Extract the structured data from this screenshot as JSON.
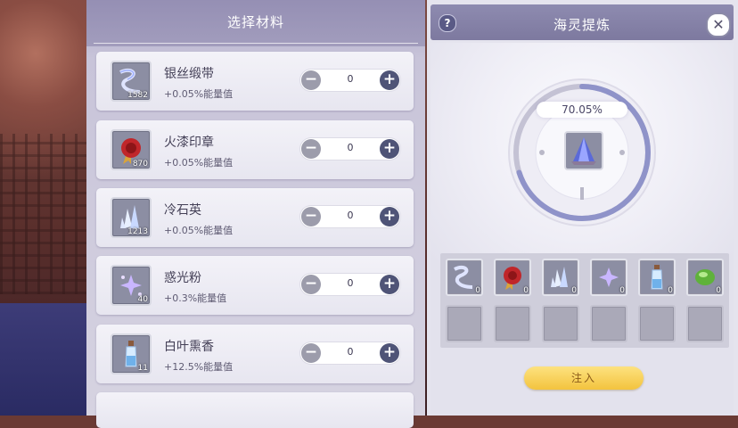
{
  "materials": {
    "title": "选择材料",
    "items": [
      {
        "name": "银丝缎带",
        "effect": "+0.05%能量值",
        "count": "1582",
        "qty": "0",
        "icon": "ribbon-icon"
      },
      {
        "name": "火漆印章",
        "effect": "+0.05%能量值",
        "count": "870",
        "qty": "0",
        "icon": "wax-seal-icon"
      },
      {
        "name": "冷石英",
        "effect": "+0.05%能量值",
        "count": "1213",
        "qty": "0",
        "icon": "quartz-icon"
      },
      {
        "name": "惑光粉",
        "effect": "+0.3%能量值",
        "count": "40",
        "qty": "0",
        "icon": "sparkle-powder-icon"
      },
      {
        "name": "白叶熏香",
        "effect": "+12.5%能量值",
        "count": "11",
        "qty": "0",
        "icon": "incense-bottle-icon"
      }
    ]
  },
  "refine": {
    "title": "海灵提炼",
    "help": "?",
    "close": "✕",
    "progress": "70.05%",
    "progress_fraction": 0.7005,
    "slots": [
      {
        "icon": "ribbon-icon",
        "count": "0"
      },
      {
        "icon": "wax-seal-icon",
        "count": "0"
      },
      {
        "icon": "quartz-icon",
        "count": "0"
      },
      {
        "icon": "sparkle-powder-icon",
        "count": "0"
      },
      {
        "icon": "incense-bottle-icon",
        "count": "0"
      },
      {
        "icon": "green-gem-icon",
        "count": "0"
      }
    ],
    "inject_label": "注入"
  },
  "colors": {
    "accent": "#4f5477",
    "header": "#8e8bb0",
    "button": "#f3c33e"
  }
}
